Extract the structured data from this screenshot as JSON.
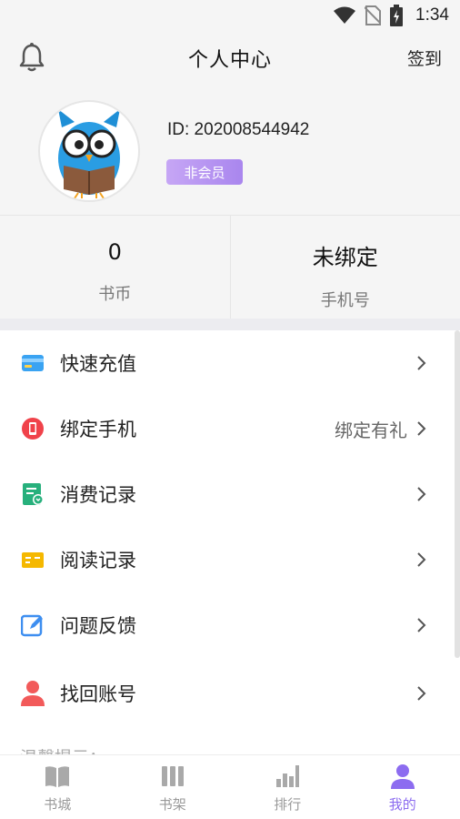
{
  "status_bar": {
    "time": "1:34",
    "icons": [
      "wifi-icon",
      "no-sim-icon",
      "battery-charging-icon"
    ]
  },
  "header": {
    "title": "个人中心",
    "sign_in": "签到",
    "left_icon": "bell-icon"
  },
  "profile": {
    "user_id": "ID: 202008544942",
    "membership": "非会员",
    "avatar": "owl-reading-avatar"
  },
  "stats": [
    {
      "value": "0",
      "label": "书币"
    },
    {
      "value": "未绑定",
      "label": "手机号"
    }
  ],
  "menu": [
    {
      "label": "快速充值",
      "extra": "",
      "icon": "card-icon"
    },
    {
      "label": "绑定手机",
      "extra": "绑定有礼",
      "icon": "phone-icon"
    },
    {
      "label": "消费记录",
      "extra": "",
      "icon": "receipt-icon"
    },
    {
      "label": "阅读记录",
      "extra": "",
      "icon": "reading-record-icon"
    },
    {
      "label": "问题反馈",
      "extra": "",
      "icon": "edit-icon"
    },
    {
      "label": "找回账号",
      "extra": "",
      "icon": "user-icon"
    }
  ],
  "tip_peek": "温馨提示：",
  "tabbar": [
    {
      "label": "书城",
      "icon": "book-icon",
      "active": false
    },
    {
      "label": "书架",
      "icon": "bookshelf-icon",
      "active": false
    },
    {
      "label": "排行",
      "icon": "ranking-icon",
      "active": false
    },
    {
      "label": "我的",
      "icon": "profile-icon",
      "active": true
    }
  ],
  "colors": {
    "accent": "#8c6cf0",
    "background": "#f5f5f5"
  }
}
